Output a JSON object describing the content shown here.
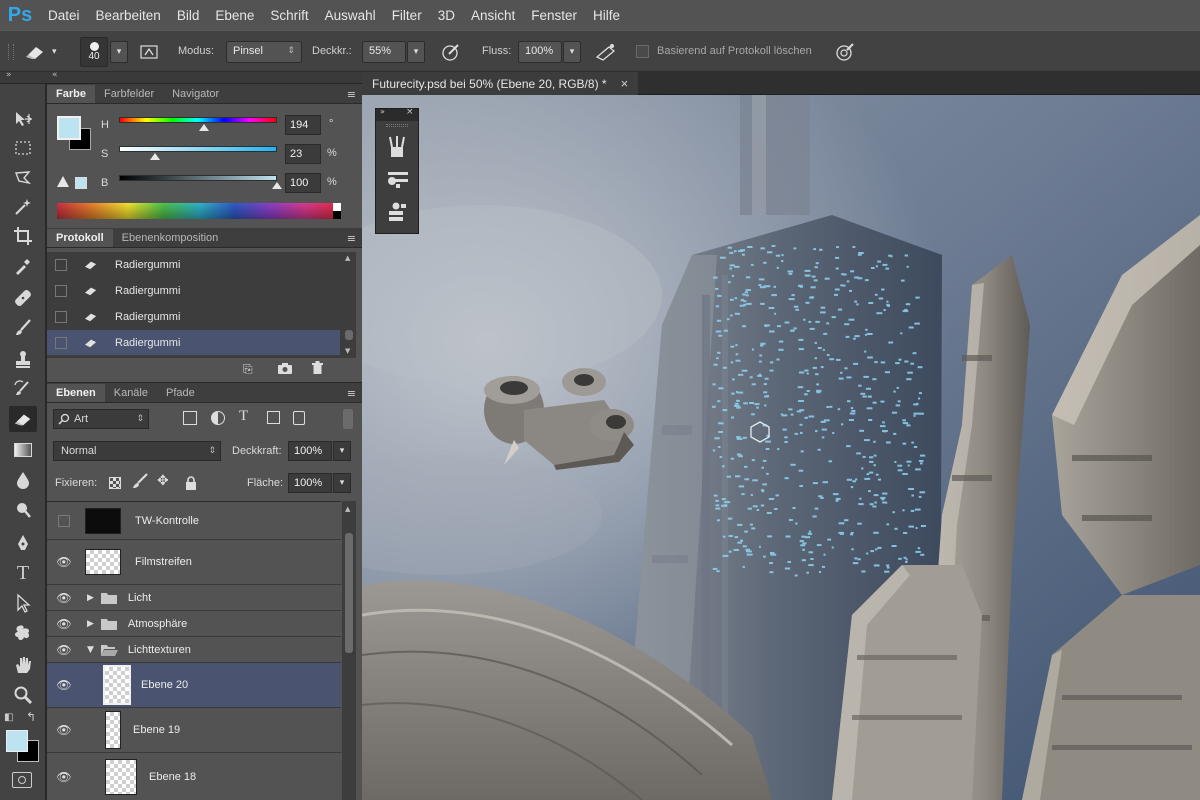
{
  "app": {
    "logo": "Ps"
  },
  "menu": [
    "Datei",
    "Bearbeiten",
    "Bild",
    "Ebene",
    "Schrift",
    "Auswahl",
    "Filter",
    "3D",
    "Ansicht",
    "Fenster",
    "Hilfe"
  ],
  "options": {
    "brush_size": "40",
    "mode_label": "Modus:",
    "mode_value": "Pinsel",
    "opacity_label": "Deckkr.:",
    "opacity_value": "55%",
    "flow_label": "Fluss:",
    "flow_value": "100%",
    "erase_history_label": "Basierend auf Protokoll löschen"
  },
  "color_panel": {
    "tabs": [
      "Farbe",
      "Farbfelder",
      "Navigator"
    ],
    "h_label": "H",
    "h_value": "194",
    "h_unit": "°",
    "h_level": 0.54,
    "s_label": "S",
    "s_value": "23",
    "s_unit": "%",
    "s_level": 0.23,
    "b_label": "B",
    "b_value": "100",
    "b_unit": "%",
    "b_level": 1.0,
    "foreground": "#bde2f0",
    "background": "#000000"
  },
  "history_panel": {
    "tabs": [
      "Protokoll",
      "Ebenenkomposition"
    ],
    "items": [
      "Radiergummi",
      "Radiergummi",
      "Radiergummi",
      "Radiergummi"
    ]
  },
  "layers_panel": {
    "tabs": [
      "Ebenen",
      "Kanäle",
      "Pfade"
    ],
    "filter_label": "Art",
    "blend_mode": "Normal",
    "opacity_label": "Deckkraft:",
    "opacity_value": "100%",
    "lock_label": "Fixieren:",
    "fill_label": "Fläche:",
    "fill_value": "100%",
    "layers": [
      {
        "name": "TW-Kontrolle",
        "visible": false,
        "type": "layer"
      },
      {
        "name": "Filmstreifen",
        "visible": true,
        "type": "layer"
      },
      {
        "name": "Licht",
        "visible": true,
        "type": "group"
      },
      {
        "name": "Atmosphäre",
        "visible": true,
        "type": "group"
      },
      {
        "name": "Lichttexturen",
        "visible": true,
        "type": "group-open"
      },
      {
        "name": "Ebene 20",
        "visible": true,
        "type": "layer"
      },
      {
        "name": "Ebene 19",
        "visible": true,
        "type": "layer"
      },
      {
        "name": "Ebene 18",
        "visible": true,
        "type": "layer"
      }
    ]
  },
  "document": {
    "tab_title": "Futurecity.psd bei 50% (Ebene 20, RGB/8) *",
    "close": "×"
  },
  "colors": {
    "accent": "#32a8e8",
    "selection": "#4a5470",
    "panel": "#535353"
  }
}
